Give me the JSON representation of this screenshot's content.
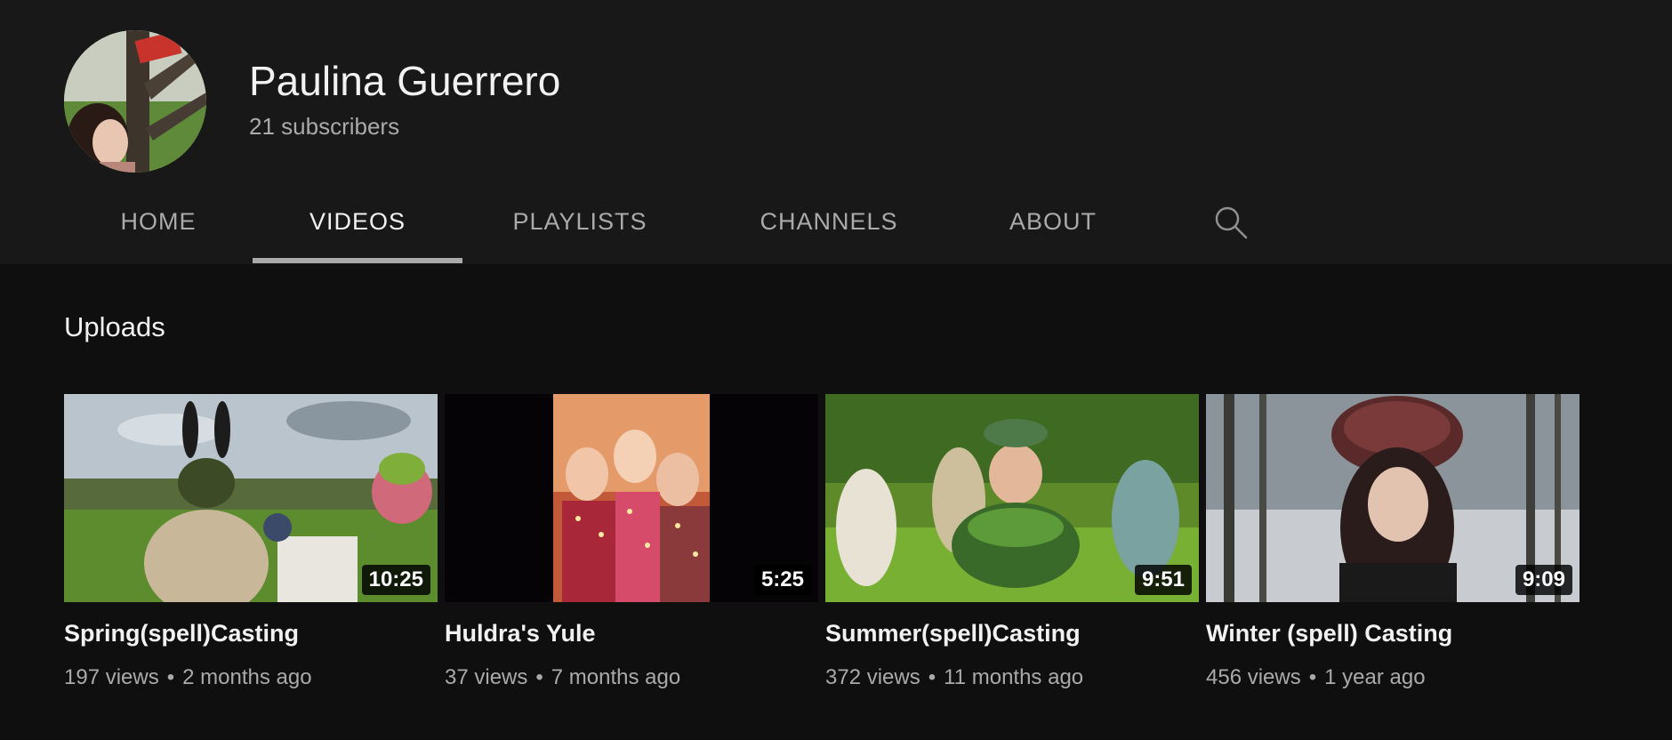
{
  "channel": {
    "name": "Paulina Guerrero",
    "subscribers": "21 subscribers"
  },
  "tabs": [
    {
      "label": "HOME",
      "active": false
    },
    {
      "label": "VIDEOS",
      "active": true
    },
    {
      "label": "PLAYLISTS",
      "active": false
    },
    {
      "label": "CHANNELS",
      "active": false
    },
    {
      "label": "ABOUT",
      "active": false
    }
  ],
  "search_icon": "search-icon",
  "section": {
    "title": "Uploads"
  },
  "videos": [
    {
      "title": "Spring(spell)Casting",
      "duration": "10:25",
      "views": "197 views",
      "age": "2 months ago"
    },
    {
      "title": "Huldra's Yule",
      "duration": "5:25",
      "views": "37 views",
      "age": "7 months ago"
    },
    {
      "title": "Summer(spell)Casting",
      "duration": "9:51",
      "views": "372 views",
      "age": "11 months ago"
    },
    {
      "title": "Winter (spell) Casting",
      "duration": "9:09",
      "views": "456 views",
      "age": "1 year ago"
    }
  ],
  "colors": {
    "header_bg": "#181818",
    "page_bg": "#0f0f0f",
    "text_primary": "#f1f1f1",
    "text_secondary": "#aaaaaa"
  }
}
